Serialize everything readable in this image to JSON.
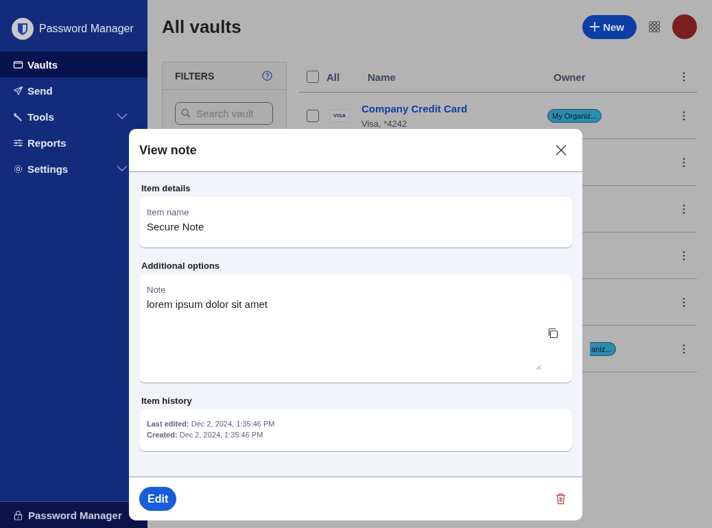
{
  "sidebar": {
    "brand": "Password Manager",
    "items": [
      {
        "label": "Vaults",
        "selected": true,
        "expandable": false
      },
      {
        "label": "Send",
        "selected": false,
        "expandable": false
      },
      {
        "label": "Tools",
        "selected": false,
        "expandable": true
      },
      {
        "label": "Reports",
        "selected": false,
        "expandable": false
      },
      {
        "label": "Settings",
        "selected": false,
        "expandable": true
      }
    ],
    "footer": "Password Manager"
  },
  "header": {
    "title": "All vaults",
    "new_button": "New"
  },
  "filters": {
    "title": "FILTERS",
    "search_placeholder": "Search vault"
  },
  "table": {
    "columns": [
      "All",
      "Name",
      "Owner"
    ],
    "select_all_checked": false,
    "rows": [
      {
        "kind": "full",
        "checked": false,
        "card_brand": "VISA",
        "name": "Company Credit Card",
        "subtitle": "Visa, *4242",
        "owner": "My Organiz..."
      },
      {
        "kind": "covered"
      },
      {
        "kind": "covered"
      },
      {
        "kind": "covered"
      },
      {
        "kind": "covered"
      },
      {
        "kind": "covered",
        "owner": "aniz..."
      }
    ]
  },
  "dialog": {
    "title": "View note",
    "sections": [
      {
        "kind": "fields",
        "heading": "Item details",
        "fields": [
          {
            "kind": "text",
            "label": "Item name",
            "value": "Secure Note"
          }
        ]
      },
      {
        "kind": "fields",
        "heading": "Additional options",
        "fields": [
          {
            "kind": "note",
            "label": "Note",
            "value": "lorem ipsum dolor sit amet"
          }
        ]
      },
      {
        "kind": "history",
        "heading": "Item history",
        "lines": [
          "**Last edited:** Dec 2, 2024, 1:35:46 PM",
          "**Created:** Dec 2, 2024, 1:35:46 PM"
        ]
      }
    ],
    "edit_button": "Edit"
  }
}
